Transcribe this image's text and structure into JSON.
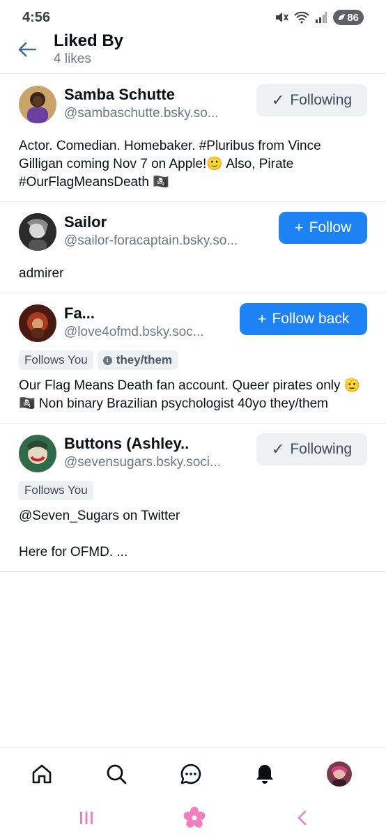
{
  "status_bar": {
    "time": "4:56",
    "battery": "86"
  },
  "header": {
    "title": "Liked By",
    "subtitle": "4 likes"
  },
  "users": [
    {
      "name": "Samba Schutte",
      "handle": "@sambaschutte.bsky.so...",
      "button_label": "Following",
      "button_kind": "following",
      "badges": [],
      "bio": "Actor. Comedian. Homebaker. #Pluribus from Vince Gilligan coming Nov 7 on Apple!🙂 Also, Pirate #OurFlagMeansDeath 🏴‍☠️"
    },
    {
      "name": "Sailor",
      "handle": "@sailor-foracaptain.bsky.so...",
      "button_label": "Follow",
      "button_kind": "follow",
      "badges": [],
      "bio": "admirer"
    },
    {
      "name": "Fa...",
      "handle": "@love4ofmd.bsky.soc...",
      "button_label": "Follow back",
      "button_kind": "follow",
      "badges": [
        "Follows You",
        "they/them"
      ],
      "bio": "Our Flag Means Death fan account. Queer pirates only 🫡🏴‍☠️ Non binary Brazilian psychologist 40yo they/them"
    },
    {
      "name": "Buttons (Ashley..",
      "handle": "@sevensugars.bsky.soci...",
      "button_label": "Following",
      "button_kind": "following",
      "badges": [
        "Follows You"
      ],
      "bio": "@Seven_Sugars on Twitter\n\nHere for OFMD. ..."
    }
  ],
  "bottom_nav": [
    "home-icon",
    "search-icon",
    "chat-icon",
    "bell-icon",
    "profile-avatar"
  ],
  "colors": {
    "accent": "#1d83f5",
    "muted": "#6b7785",
    "divider": "#e6e9ec",
    "system_nav": "#f07fbf"
  }
}
